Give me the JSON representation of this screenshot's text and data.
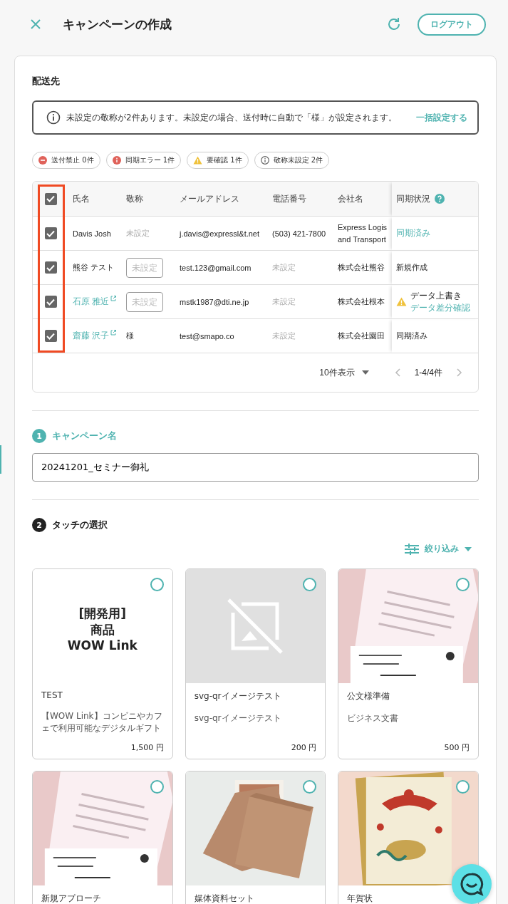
{
  "header": {
    "title": "キャンペーンの作成",
    "logout": "ログアウト"
  },
  "recipients": {
    "heading": "配送先",
    "notice": {
      "text": "未設定の敬称が2件あります。未設定の場合、送付時に自動で「様」が設定されます。",
      "action": "一括設定する"
    },
    "filters": [
      {
        "kind": "blocked",
        "label": "送付禁止 0件"
      },
      {
        "kind": "error",
        "label": "同期エラー 1件"
      },
      {
        "kind": "warning",
        "label": "要確認 1件"
      },
      {
        "kind": "info",
        "label": "敬称未設定 2件"
      }
    ],
    "table": {
      "all_checked": true,
      "highlighted_column": true,
      "columns": [
        "氏名",
        "敬称",
        "メールアドレス",
        "電話番号",
        "会社名",
        "同期状況"
      ],
      "rows": [
        {
          "checked": true,
          "name": "Davis Josh",
          "name_link": false,
          "honorific": {
            "kind": "empty",
            "text": "未設定"
          },
          "email": "j.davis@expressl&t.net",
          "phone": {
            "kind": "value",
            "text": "(503) 421-7800"
          },
          "company": "Express Logis and Transport",
          "sync": {
            "kind": "link",
            "text": "同期済み"
          }
        },
        {
          "checked": true,
          "name": "熊谷 テスト",
          "name_link": false,
          "honorific": {
            "kind": "input",
            "placeholder": "未設定"
          },
          "email": "test.123@gmail.com",
          "phone": {
            "kind": "empty",
            "text": "未設定"
          },
          "company": "株式会社熊谷",
          "sync": {
            "kind": "plain",
            "text": "新規作成"
          }
        },
        {
          "checked": true,
          "name": "石原 雅近",
          "name_link": true,
          "honorific": {
            "kind": "input",
            "placeholder": "未設定"
          },
          "email": "mstk1987@dti.ne.jp",
          "phone": {
            "kind": "empty",
            "text": "未設定"
          },
          "company": "株式会社根本",
          "sync": {
            "kind": "warning",
            "text": "データ上書き",
            "detail": "データ差分確認"
          }
        },
        {
          "checked": true,
          "name": "齋藤 沢子",
          "name_link": true,
          "honorific": {
            "kind": "value",
            "text": "様"
          },
          "email": "test@smapo.co",
          "phone": {
            "kind": "empty",
            "text": "未設定"
          },
          "company": "株式会社園田",
          "sync": {
            "kind": "plain",
            "text": "同期済み"
          }
        }
      ]
    },
    "pagination": {
      "per_page": "10件表示",
      "range": "1-4/4件"
    }
  },
  "campaign": {
    "step": "1",
    "active": true,
    "label": "キャンペーン名",
    "value": "20241201_セミナー御礼"
  },
  "touch": {
    "step": "2",
    "active": false,
    "label": "タッチの選択",
    "filter": "絞り込み",
    "cards": [
      {
        "kind": "text",
        "image_lines": [
          "[開発用]",
          "商品",
          "WOW Link"
        ],
        "selected": false,
        "title": "TEST",
        "description": "【WOW Link】コンビニやカフェで利用可能なデジタルギフト",
        "price": "1,500 円"
      },
      {
        "kind": "placeholder",
        "selected": false,
        "title": "svg-qrイメージテスト",
        "description": "svg-qrイメージテスト",
        "price": "200 円"
      },
      {
        "kind": "picture",
        "selected": false,
        "title": "公文様準備",
        "description": "ビジネス文書",
        "price": "500 円"
      },
      {
        "kind": "picture",
        "selected": false,
        "title": "新規アプローチ"
      },
      {
        "kind": "picture",
        "selected": false,
        "title": "媒体資料セット"
      },
      {
        "kind": "picture",
        "selected": false,
        "title": "年賀状"
      }
    ]
  }
}
